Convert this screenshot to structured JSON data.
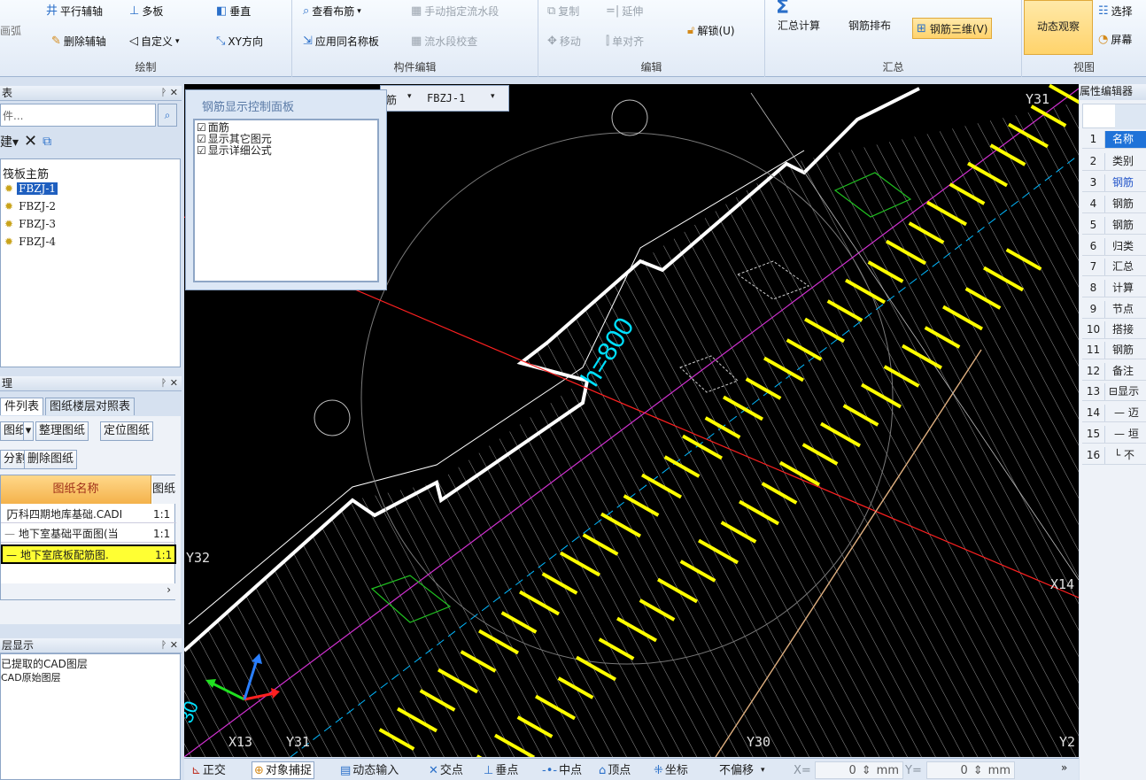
{
  "ribbon": {
    "groups": {
      "draw": "绘制",
      "component_edit": "构件编辑",
      "edit": "编辑",
      "summary": "汇总",
      "view": "视图"
    },
    "draw": {
      "arc": "画弧",
      "parallel_axis": "平行辅轴",
      "multi_board": "多板",
      "vertical": "垂直",
      "delete_axis": "删除辅轴",
      "custom": "自定义",
      "xy_direction": "XY方向"
    },
    "component": {
      "view_rebar": "查看布筋",
      "manual_flow": "手动指定流水段",
      "apply_same_name": "应用同名称板",
      "flow_check": "流水段校查"
    },
    "edit": {
      "copy": "复制",
      "extend": "延伸",
      "move": "移动",
      "align": "单对齐",
      "unlock": "解锁(U)"
    },
    "summary": {
      "calc": "汇总计算",
      "rebar_layout": "钢筋排布",
      "rebar_3d": "钢筋三维(V)"
    },
    "view": {
      "dynamic": "动态观察",
      "select": "选择",
      "screen": "屏幕"
    }
  },
  "component_list": {
    "title": "表",
    "search_placeholder": "件...",
    "new_label": "建",
    "group": "筏板主筋",
    "items": [
      "FBZJ-1",
      "FBZJ-2",
      "FBZJ-3",
      "FBZJ-4"
    ]
  },
  "toolbar_combo": {
    "type": "筋",
    "value": "FBZJ-1"
  },
  "rebar_panel": {
    "title": "钢筋显示控制面板",
    "options": [
      "面筋",
      "显示其它图元",
      "显示详细公式"
    ]
  },
  "drawing_manager": {
    "title": "理",
    "tabs": [
      "件列表",
      "图纸楼层对照表"
    ],
    "buttons": [
      "图纸",
      "整理图纸",
      "定位图纸",
      "分割",
      "删除图纸"
    ],
    "col_name": "图纸名称",
    "col_scale": "图纸",
    "rows": [
      {
        "name": "万科四期地库基础.CADI",
        "scale": "1:1"
      },
      {
        "name": "地下室基础平面图(当",
        "scale": "1:1"
      },
      {
        "name": "地下室底板配筋图.",
        "scale": "1:1"
      }
    ]
  },
  "layer_display": {
    "title": "层显示",
    "items": [
      "已提取的CAD图层",
      "CAD原始图层"
    ]
  },
  "viewport": {
    "labels": {
      "h800": "h=800",
      "y31_top": "Y31",
      "y32": "Y32",
      "x13": "X13",
      "y31_bottom": "Y31",
      "y30": "Y30",
      "x14": "X14",
      "y2": "Y2",
      "left_num": "30"
    },
    "colors": {
      "bg": "#000000",
      "slab": "#ffffff",
      "rebar": "#ffff00",
      "axis_red": "#ff2020",
      "axis_magenta": "#d030d0",
      "axis_cyan": "#00e0ff"
    }
  },
  "property_editor": {
    "title": "属性编辑器",
    "rows": [
      {
        "num": "1",
        "text": "名称"
      },
      {
        "num": "2",
        "text": "类别"
      },
      {
        "num": "3",
        "text": "钢筋"
      },
      {
        "num": "4",
        "text": "钢筋"
      },
      {
        "num": "5",
        "text": "钢筋"
      },
      {
        "num": "6",
        "text": "归类"
      },
      {
        "num": "7",
        "text": "汇总"
      },
      {
        "num": "8",
        "text": "计算"
      },
      {
        "num": "9",
        "text": "节点"
      },
      {
        "num": "10",
        "text": "搭接"
      },
      {
        "num": "11",
        "text": "钢筋"
      },
      {
        "num": "12",
        "text": "备注"
      },
      {
        "num": "13",
        "text": "显示"
      },
      {
        "num": "14",
        "text": "迈"
      },
      {
        "num": "15",
        "text": "垣"
      },
      {
        "num": "16",
        "text": "不"
      }
    ]
  },
  "status_bar": {
    "ortho": "正交",
    "snap": "对象捕捉",
    "dyn_input": "动态输入",
    "intersection": "交点",
    "perpendicular": "垂点",
    "midpoint": "中点",
    "vertex": "顶点",
    "coord": "坐标",
    "offset": "不偏移",
    "x_label": "X=",
    "x_value": "0",
    "x_unit": "mm",
    "y_label": "Y=",
    "y_value": "0",
    "y_unit": "mm"
  }
}
